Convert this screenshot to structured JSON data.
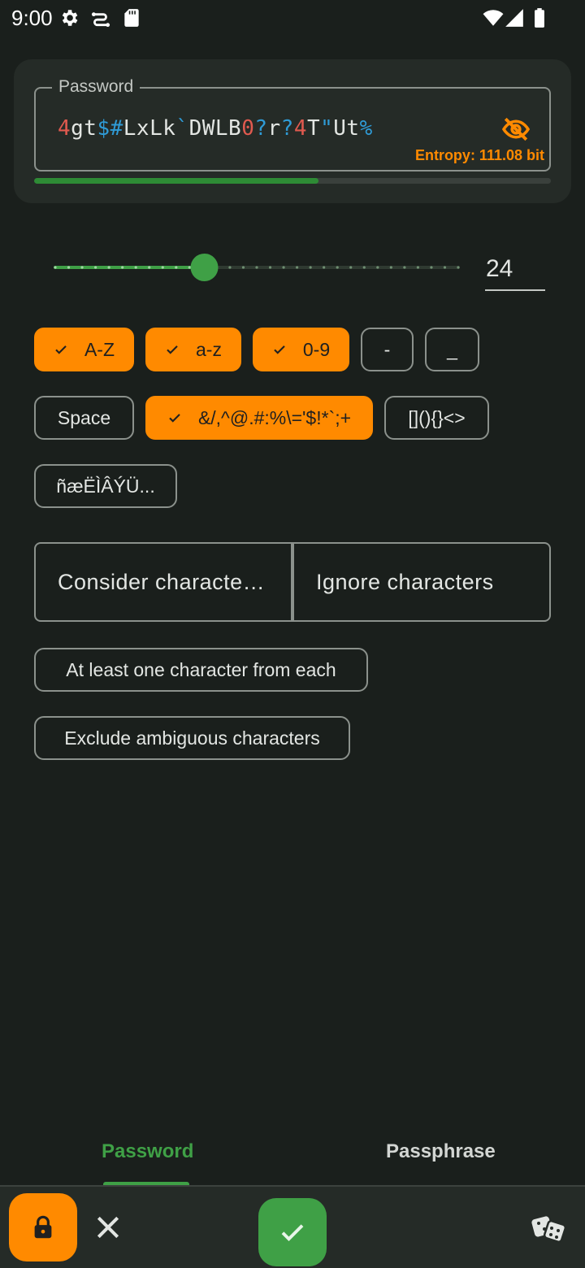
{
  "status_bar": {
    "time": "9:00",
    "icons": [
      "settings-icon",
      "network-icon",
      "sd-card-icon",
      "wifi-icon",
      "signal-icon",
      "battery-icon"
    ]
  },
  "password": {
    "label": "Password",
    "segments": [
      {
        "text": "4",
        "color": "#e05a4f"
      },
      {
        "text": "gt",
        "color": "#e3e6e3"
      },
      {
        "text": "$",
        "color": "#2f9bd6"
      },
      {
        "text": "#",
        "color": "#2f9bd6"
      },
      {
        "text": "LxLk",
        "color": "#e3e6e3"
      },
      {
        "text": "`",
        "color": "#2f9bd6"
      },
      {
        "text": "DWLB",
        "color": "#e3e6e3"
      },
      {
        "text": "0",
        "color": "#e05a4f"
      },
      {
        "text": "?",
        "color": "#2f9bd6"
      },
      {
        "text": "r",
        "color": "#e3e6e3"
      },
      {
        "text": "?",
        "color": "#2f9bd6"
      },
      {
        "text": "4",
        "color": "#e05a4f"
      },
      {
        "text": "T",
        "color": "#e3e6e3"
      },
      {
        "text": "\"",
        "color": "#2f9bd6"
      },
      {
        "text": "Ut",
        "color": "#e3e6e3"
      },
      {
        "text": "%",
        "color": "#2f9bd6"
      }
    ],
    "entropy_text": "Entropy: 111.08 bit",
    "strength_fraction": 0.55,
    "visibility_icon": "eye-off-icon"
  },
  "length": {
    "value": "24",
    "slider_fraction": 0.37,
    "tick_count": 31
  },
  "chips": {
    "upper": {
      "label": "A-Z",
      "selected": true
    },
    "lower": {
      "label": "a-z",
      "selected": true
    },
    "digits": {
      "label": "0-9",
      "selected": true
    },
    "dash": {
      "label": "-",
      "selected": false
    },
    "underscore": {
      "label": "_",
      "selected": false
    },
    "space": {
      "label": "Space",
      "selected": false
    },
    "symbols": {
      "label": "&/,^@.#:%\\='$!*`;+",
      "selected": true
    },
    "brackets": {
      "label": "[](){}<>",
      "selected": false
    },
    "accents": {
      "label": "ñæËÌÂÝÜ...",
      "selected": false
    },
    "at_least_one": {
      "label": "At least one character from each",
      "selected": false
    },
    "exclude_ambiguous": {
      "label": "Exclude ambiguous characters",
      "selected": false
    }
  },
  "fields": {
    "consider": "Consider characte…",
    "ignore": "Ignore characters"
  },
  "tabs": {
    "password": "Password",
    "passphrase": "Passphrase"
  },
  "colors": {
    "accent_orange": "#ff8a00",
    "accent_green": "#3fa046",
    "background": "#1a1f1c",
    "surface": "#252b27"
  },
  "bottom_bar": {
    "icons": [
      "lock-icon",
      "close-icon",
      "check-icon",
      "dice-icon"
    ]
  }
}
